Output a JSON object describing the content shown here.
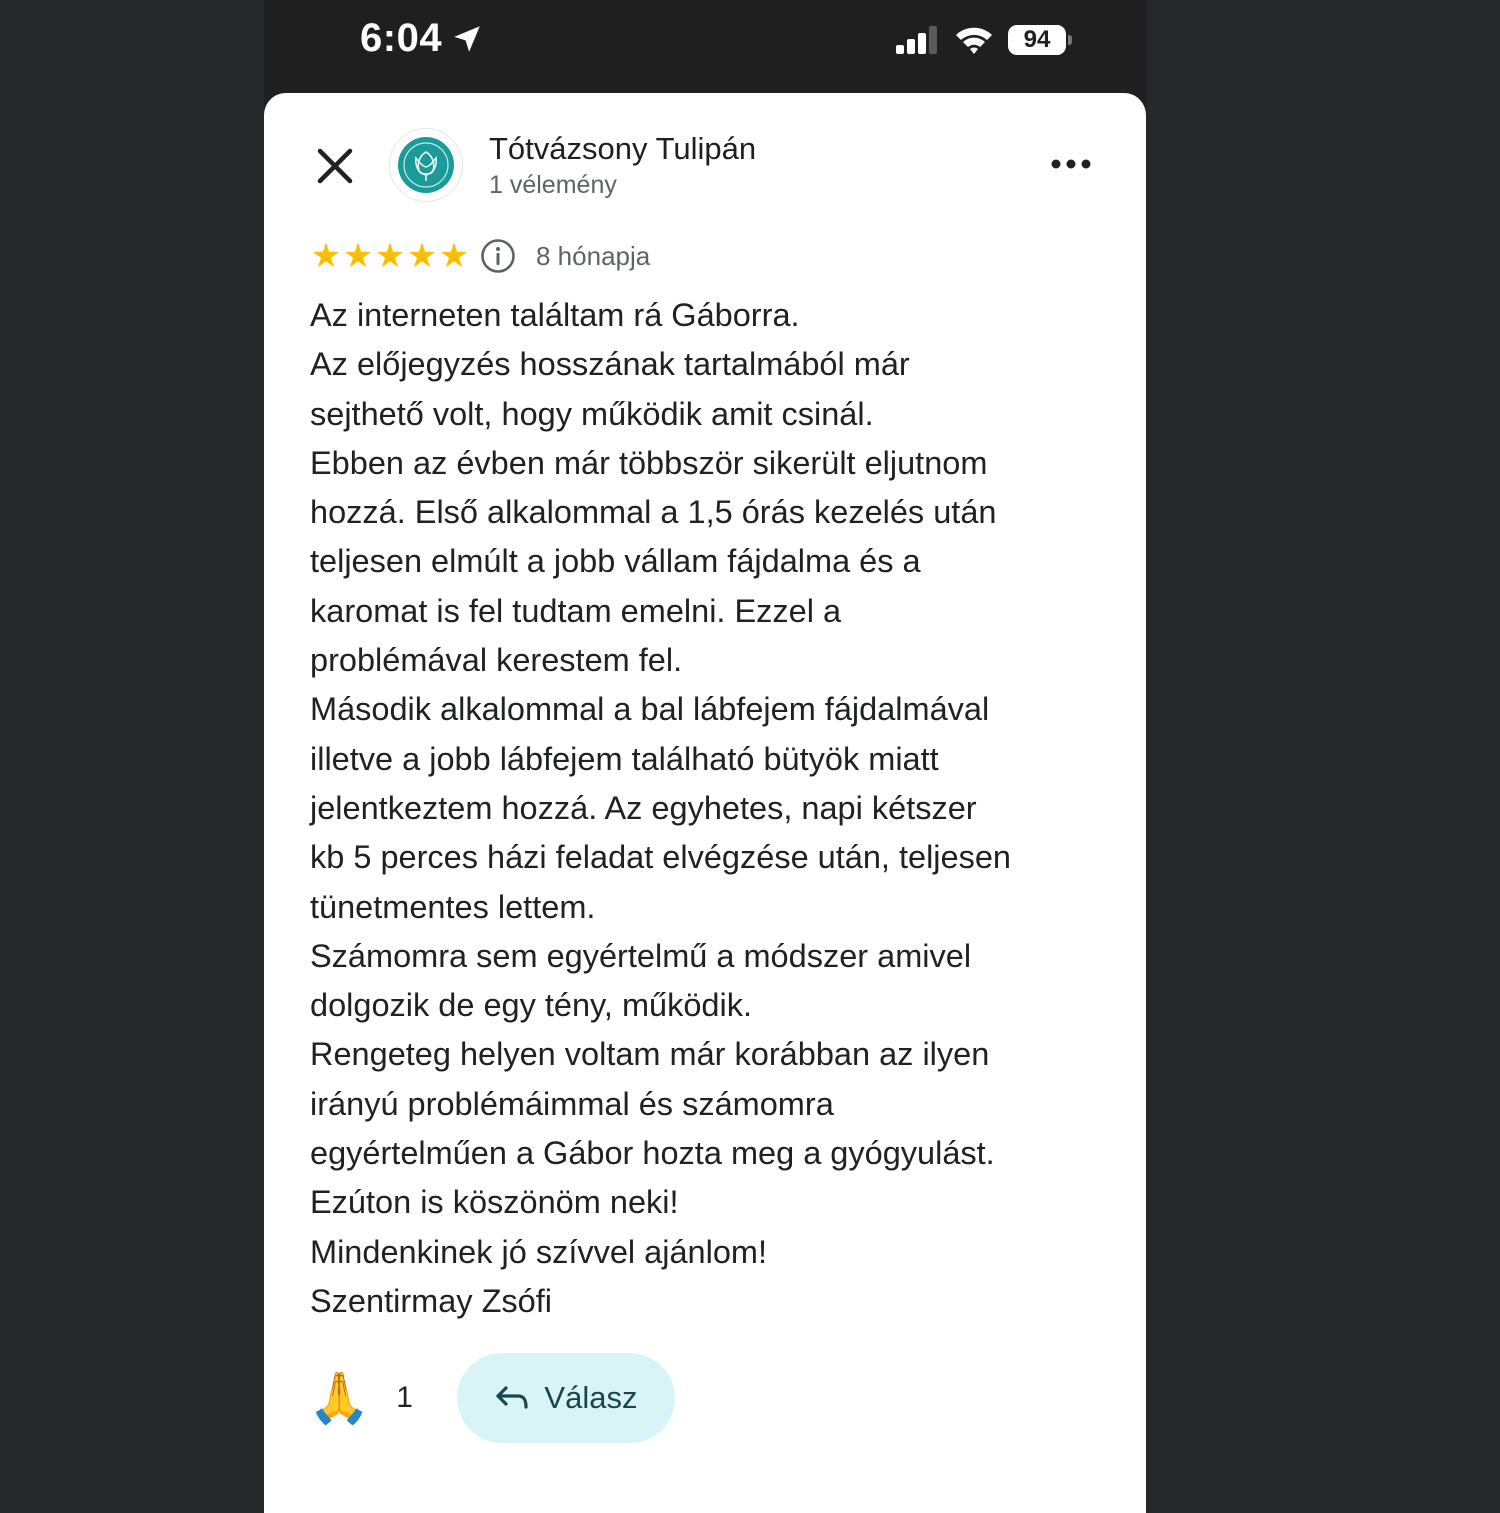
{
  "status_bar": {
    "time": "6:04",
    "battery": "94",
    "icons": [
      "location-arrow-icon",
      "signal-icon",
      "wifi-icon",
      "battery-icon"
    ]
  },
  "header": {
    "place_name": "Tótvázsony Tulipán",
    "review_count": "1 vélemény",
    "icons": [
      "close-icon",
      "tulip-logo-icon",
      "more-options-icon"
    ]
  },
  "review": {
    "rating": 5,
    "age": "8 hónapja",
    "lines": [
      "Az interneten találtam rá Gáborra.",
      "Az előjegyzés hosszának tartalmából már",
      "sejthető volt, hogy működik amit csinál.",
      "Ebben az évben már többször sikerült eljutnom",
      "hozzá. Első alkalommal a 1,5 órás kezelés után",
      "teljesen elmúlt a jobb vállam fájdalma és a",
      "karomat is fel tudtam emelni. Ezzel a",
      "problémával kerestem fel.",
      "Második alkalommal a bal lábfejem fájdalmával",
      "illetve a jobb lábfejem található bütyök miatt",
      "jelentkeztem hozzá. Az egyhetes, napi kétszer",
      "kb 5 perces házi feladat elvégzése után, teljesen",
      "tünetmentes lettem.",
      "Számomra sem egyértelmű a módszer amivel",
      "dolgozik de egy tény, működik.",
      "Rengeteg helyen voltam már korábban az ilyen",
      "irányú problémáimmal és számomra",
      "egyértelműen a Gábor  hozta meg a gyógyulást.",
      "Ezúton is köszönöm neki!",
      "Mindenkinek jó szívvel ajánlom!",
      "Szentirmay Zsófi"
    ]
  },
  "actions": {
    "reaction_emoji": "🙏",
    "reaction_count": "1",
    "reply_label": "Válasz"
  },
  "colors": {
    "star": "#fbbc04",
    "reply_bg": "#d9f4f6",
    "reply_text": "#17464c",
    "logo": "#1a9a98"
  }
}
